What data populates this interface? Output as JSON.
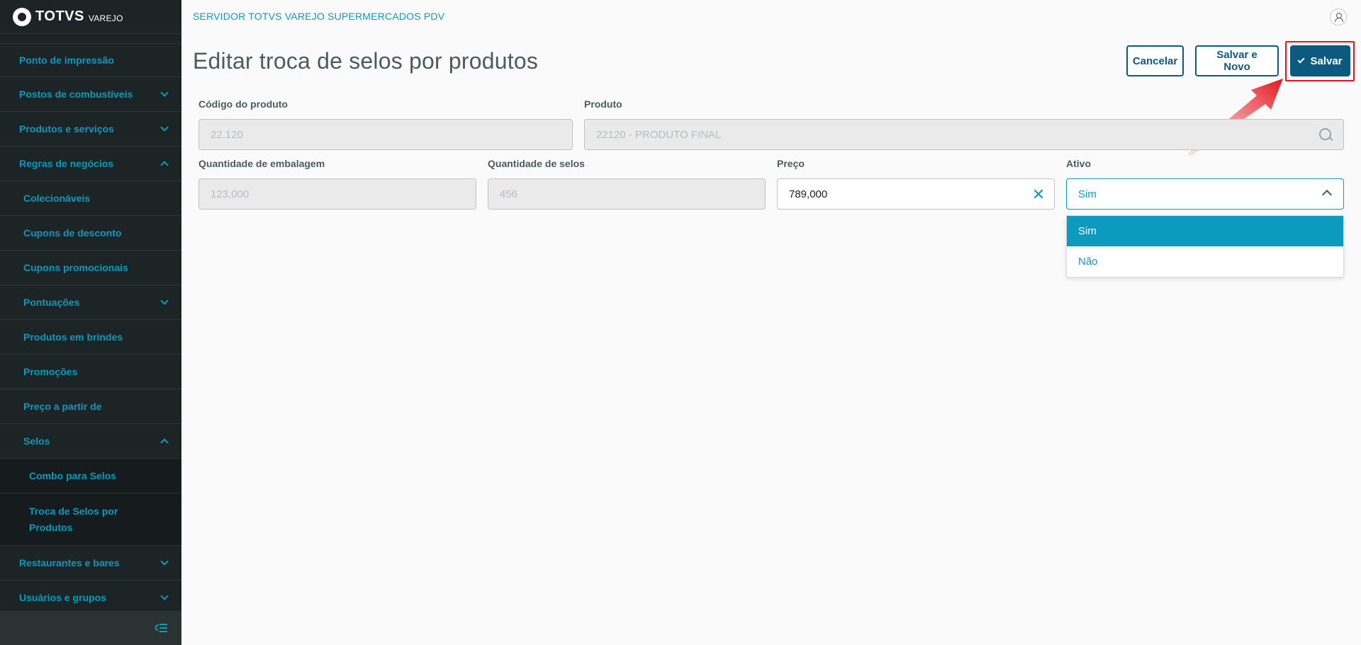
{
  "brand": {
    "name": "TOTVS",
    "sub": "VAREJO"
  },
  "header": {
    "server_title": "SERVIDOR TOTVS VAREJO SUPERMERCADOS PDV"
  },
  "sidebar": {
    "items": [
      {
        "label": "Ponto de impressão"
      },
      {
        "label": "Postos de combustíveis"
      },
      {
        "label": "Produtos e serviços"
      },
      {
        "label": "Regras de negócios"
      },
      {
        "label": "Colecionáveis"
      },
      {
        "label": "Cupons de desconto"
      },
      {
        "label": "Cupons promocionais"
      },
      {
        "label": "Pontuações"
      },
      {
        "label": "Produtos em brindes"
      },
      {
        "label": "Promoções"
      },
      {
        "label": "Preço a partir de"
      },
      {
        "label": "Selos"
      },
      {
        "label": "Combo para Selos"
      },
      {
        "label": "Troca de Selos por Produtos"
      },
      {
        "label": "Restaurantes e bares"
      },
      {
        "label": "Usuários e grupos"
      }
    ]
  },
  "page": {
    "title": "Editar troca de selos por produtos",
    "buttons": {
      "cancel": "Cancelar",
      "save_new": "Salvar e Novo",
      "save": "Salvar"
    }
  },
  "form": {
    "codigo": {
      "label": "Código do produto",
      "value": "22.120"
    },
    "produto": {
      "label": "Produto",
      "value": "22120 - PRODUTO FINAL"
    },
    "qtd_embalagem": {
      "label": "Quantidade de embalagem",
      "value": "123,000"
    },
    "qtd_selos": {
      "label": "Quantidade de selos",
      "value": "456"
    },
    "preco": {
      "label": "Preço",
      "value": "789,000"
    },
    "ativo": {
      "label": "Ativo",
      "value": "Sim",
      "options": [
        "Sim",
        "Não"
      ]
    }
  },
  "colors": {
    "accent": "#0c9abe",
    "primary": "#0c5a80",
    "sidebar_bg": "#1d2426",
    "highlight": "#e3161f"
  }
}
